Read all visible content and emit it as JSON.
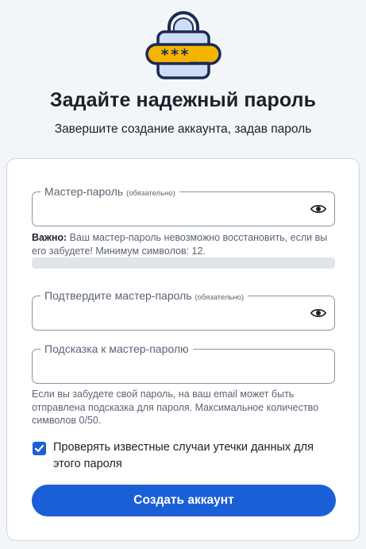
{
  "header": {
    "icon": "lock-password-icon",
    "password_mask": "***__",
    "title": "Задайте надежный пароль",
    "subtitle": "Завершите создание аккаунта, задав пароль"
  },
  "form": {
    "master_password": {
      "label": "Мастер-пароль",
      "required_note": "(обязательно)",
      "value": "",
      "toggle_icon": "eye-icon"
    },
    "warning": {
      "strong": "Важно:",
      "text": " Ваш мастер-пароль невозможно восстановить, если вы его забудете! Минимум символов: 12."
    },
    "strength_level": 0,
    "confirm_password": {
      "label": "Подтвердите мастер-пароль",
      "required_note": "(обязательно)",
      "value": "",
      "toggle_icon": "eye-icon"
    },
    "hint": {
      "label": "Подсказка к мастер-паролю",
      "value": "",
      "helper": "Если вы забудете свой пароль, на ваш email может быть отправлена подсказка для пароля. Максимальное количество символов 0/50."
    },
    "breach_check": {
      "checked": true,
      "label": "Проверять известные случаи утечки данных для этого пароля"
    },
    "submit_label": "Создать аккаунт"
  },
  "colors": {
    "primary": "#1b5fd6",
    "background": "#f3f6f9",
    "lock_body": "#cfdcf5",
    "lock_outline": "#1b2a55",
    "password_strip": "#f5b400"
  }
}
